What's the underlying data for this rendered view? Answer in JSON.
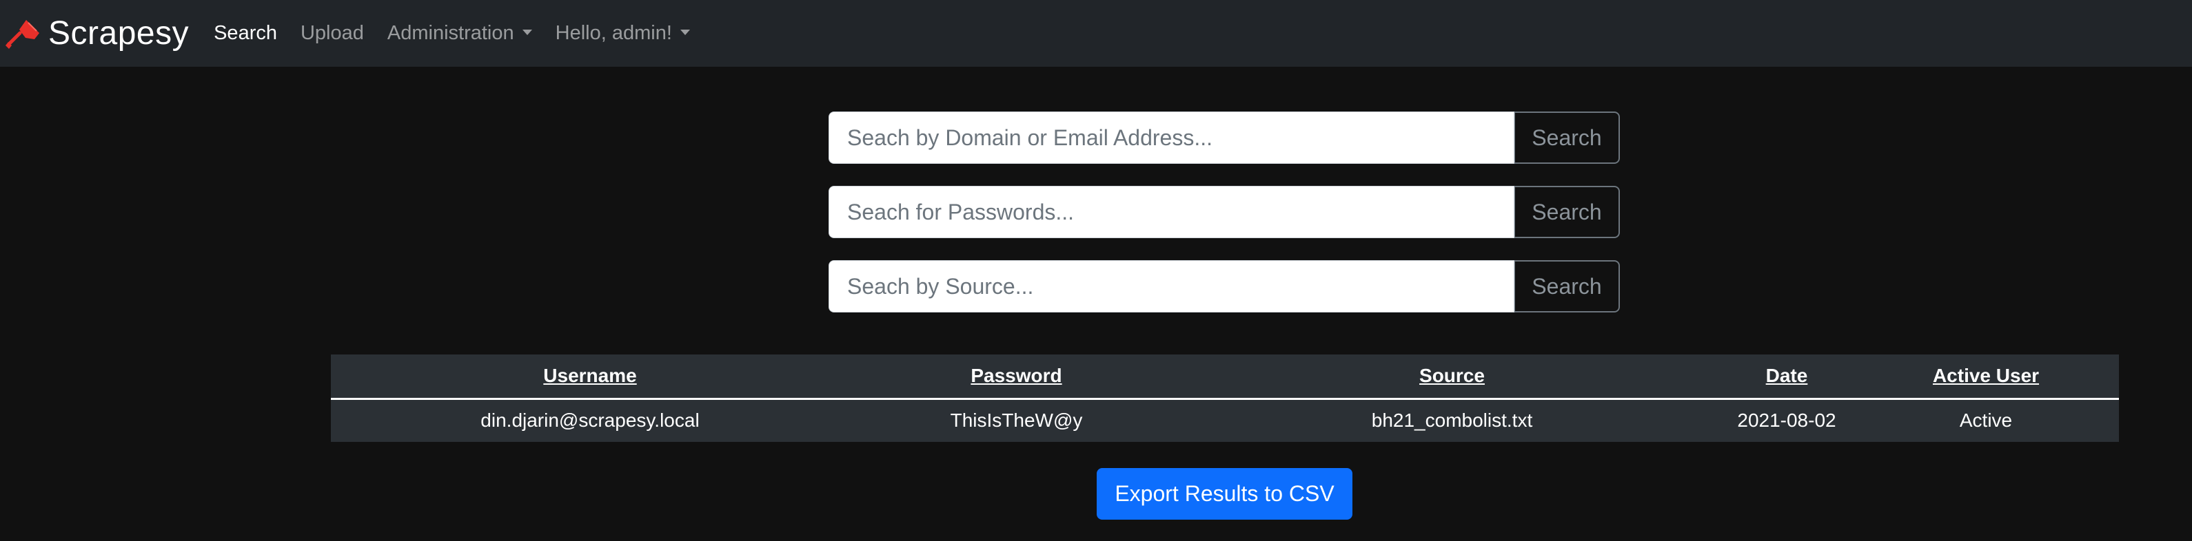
{
  "navbar": {
    "brand": "Scrapesy",
    "links": [
      {
        "label": "Search"
      },
      {
        "label": "Upload"
      },
      {
        "label": "Administration"
      },
      {
        "label": "Hello, admin!"
      }
    ]
  },
  "search": {
    "domain": {
      "placeholder": "Seach by Domain or Email Address...",
      "value": "",
      "button": "Search"
    },
    "password": {
      "placeholder": "Seach for Passwords...",
      "value": "",
      "button": "Search"
    },
    "source": {
      "placeholder": "Seach by Source...",
      "value": "",
      "button": "Search"
    }
  },
  "table": {
    "headers": [
      "Username",
      "Password",
      "Source",
      "Date",
      "Active User"
    ],
    "rows": [
      [
        "din.djarin@scrapesy.local",
        "ThisIsTheW@y",
        "bh21_combolist.txt",
        "2021-08-02",
        "Active"
      ]
    ]
  },
  "export_button": "Export Results to CSV",
  "colors": {
    "navbar_bg": "#212529",
    "page_bg": "#111111",
    "table_bg": "#2b3035",
    "primary": "#0d6efd",
    "logo_red": "#e8302a"
  },
  "icons": {
    "brand": "shovel-icon",
    "dropdown": "caret-down-icon"
  }
}
